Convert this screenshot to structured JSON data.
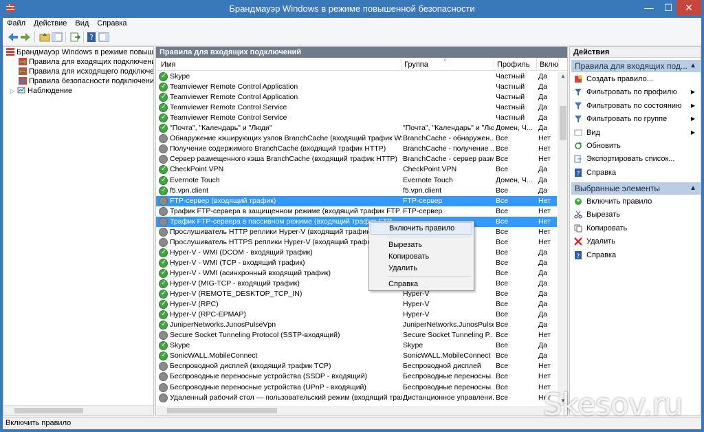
{
  "window": {
    "title": "Брандмауэр Windows в режиме повышенной безопасности",
    "min": "—",
    "max": "☐",
    "close": "✕"
  },
  "menu": [
    "Файл",
    "Действие",
    "Вид",
    "Справка"
  ],
  "tree": {
    "root": "Брандмауэр Windows в режиме повышенно",
    "items": [
      "Правила для входящих подключений",
      "Правила для исходящего подключения",
      "Правила безопасности подключения",
      "Наблюдение"
    ]
  },
  "center": {
    "header": "Правила для входящих подключений",
    "columns": [
      "Имя",
      "Группа",
      "Профиль",
      "Включ"
    ],
    "rows": [
      {
        "status": "on",
        "name": "Skype",
        "group": "",
        "profile": "Частный",
        "enabled": "Да"
      },
      {
        "status": "on",
        "name": "Teamviewer Remote Control Application",
        "group": "",
        "profile": "Частный",
        "enabled": "Да"
      },
      {
        "status": "on",
        "name": "Teamviewer Remote Control Application",
        "group": "",
        "profile": "Частный",
        "enabled": "Да"
      },
      {
        "status": "on",
        "name": "Teamviewer Remote Control Service",
        "group": "",
        "profile": "Частный",
        "enabled": "Да"
      },
      {
        "status": "on",
        "name": "Teamviewer Remote Control Service",
        "group": "",
        "profile": "Частный",
        "enabled": "Да"
      },
      {
        "status": "on",
        "name": "\"Почта\", \"Календарь\" и \"Люди\"",
        "group": "\"Почта\", \"Календарь\" и \"Люди\"",
        "profile": "Домен, Ч...",
        "enabled": "Да"
      },
      {
        "status": "off",
        "name": "Обнаружение кэширующих узлов BranchCache (входящий трафик WSD)",
        "group": "BranchCache - обнаружен...",
        "profile": "Все",
        "enabled": "Нет"
      },
      {
        "status": "off",
        "name": "Получение содержимого BranchCache (входящий трафик HTTP)",
        "group": "BranchCache - получение ...",
        "profile": "Все",
        "enabled": "Нет"
      },
      {
        "status": "off",
        "name": "Сервер размещенного кэша BranchCache (входящий трафик HTTP)",
        "group": "BranchCache - сервер разм...",
        "profile": "Все",
        "enabled": "Нет"
      },
      {
        "status": "on",
        "name": "CheckPoint.VPN",
        "group": "CheckPoint.VPN",
        "profile": "Все",
        "enabled": "Да"
      },
      {
        "status": "on",
        "name": "Evernote Touch",
        "group": "Evernote Touch",
        "profile": "Домен, Ч...",
        "enabled": "Да"
      },
      {
        "status": "on",
        "name": "f5.vpn.client",
        "group": "f5.vpn.client",
        "profile": "Все",
        "enabled": "Да"
      },
      {
        "status": "off",
        "name": "FTP-сервер (входящий трафик)",
        "group": "FTP-сервер",
        "profile": "Все",
        "enabled": "Нет",
        "selected": true
      },
      {
        "status": "off",
        "name": "Трафик FTP-сервера в защищенном режиме (входящий трафик FTP SSL)",
        "group": "FTP-сервер",
        "profile": "Все",
        "enabled": "Нет"
      },
      {
        "status": "off",
        "name": "Трафик FTP-сервера в пассивном режиме (входящий трафик FTP",
        "group": "",
        "profile": "Все",
        "enabled": "Нет",
        "selected": true
      },
      {
        "status": "off",
        "name": "Прослушиватель HTTP реплики Hyper-V (входящий трафик TCP)",
        "group": "",
        "profile": "Все",
        "enabled": "Нет"
      },
      {
        "status": "off",
        "name": "Прослушиватель HTTPS реплики Hyper-V (входящий трафик TCP)",
        "group": "",
        "profile": "Все",
        "enabled": "Нет"
      },
      {
        "status": "on",
        "name": "Hyper-V - WMI (DCOM - входящий трафик)",
        "group": "",
        "profile": "Все",
        "enabled": "Да"
      },
      {
        "status": "on",
        "name": "Hyper-V - WMI (TCP - входящий трафик)",
        "group": "",
        "profile": "Все",
        "enabled": "Да"
      },
      {
        "status": "on",
        "name": "Hyper-V - WMI (асинхронный входящий трафик)",
        "group": "",
        "profile": "Все",
        "enabled": "Да"
      },
      {
        "status": "on",
        "name": "Hyper-V (MIG-TCP - входящий трафик)",
        "group": "",
        "profile": "Все",
        "enabled": "Да"
      },
      {
        "status": "on",
        "name": "Hyper-V (REMOTE_DESKTOP_TCP_IN)",
        "group": "Hyper-V",
        "profile": "Все",
        "enabled": "Да"
      },
      {
        "status": "on",
        "name": "Hyper-V (RPC)",
        "group": "Hyper-V",
        "profile": "Все",
        "enabled": "Да"
      },
      {
        "status": "on",
        "name": "Hyper-V (RPC-EPMAP)",
        "group": "Hyper-V",
        "profile": "Все",
        "enabled": "Да"
      },
      {
        "status": "on",
        "name": "JuniperNetworks.JunosPulseVpn",
        "group": "JuniperNetworks.JunosPulse...",
        "profile": "Все",
        "enabled": "Да"
      },
      {
        "status": "off",
        "name": "Secure Socket Tunneling Protocol (SSTP-входящий)",
        "group": "Secure Socket Tunneling P...",
        "profile": "Все",
        "enabled": "Нет"
      },
      {
        "status": "on",
        "name": "Skype",
        "group": "Skype",
        "profile": "Все",
        "enabled": "Да"
      },
      {
        "status": "on",
        "name": "SonicWALL.MobileConnect",
        "group": "SonicWALL.MobileConnect",
        "profile": "Все",
        "enabled": "Да"
      },
      {
        "status": "off",
        "name": "Беспроводной дисплей (входящий трафик TCP)",
        "group": "Беспроводной дисплей",
        "profile": "Все",
        "enabled": "Нет"
      },
      {
        "status": "off",
        "name": "Беспроводные переносные устройства (SSDP - входящий)",
        "group": "Беспроводные переносны...",
        "profile": "Все",
        "enabled": "Нет"
      },
      {
        "status": "off",
        "name": "Беспроводные переносные устройства (UPnP - входящий)",
        "group": "Беспроводные переносны...",
        "profile": "Все",
        "enabled": "Нет"
      },
      {
        "status": "off",
        "name": "Удаленный рабочий стол — пользовательский режим (входящий трафик ...",
        "group": "Дистанционное управлени...",
        "profile": "Все",
        "enabled": "Нет"
      }
    ]
  },
  "actions": {
    "title": "Действия",
    "section1": "Правила для входящих под...",
    "section1_items": [
      {
        "label": "Создать правило...",
        "icon": "new-rule-icon",
        "sub": false
      },
      {
        "label": "Фильтровать по профилю",
        "icon": "filter-icon",
        "sub": true
      },
      {
        "label": "Фильтровать по состоянию",
        "icon": "filter-icon",
        "sub": true
      },
      {
        "label": "Фильтровать по группе",
        "icon": "filter-icon",
        "sub": true
      },
      {
        "label": "Вид",
        "icon": "view-icon",
        "sub": true
      },
      {
        "label": "Обновить",
        "icon": "refresh-icon",
        "sub": false
      },
      {
        "label": "Экспортировать список...",
        "icon": "export-icon",
        "sub": false
      },
      {
        "label": "Справка",
        "icon": "help-icon",
        "sub": false
      }
    ],
    "section2": "Выбранные элементы",
    "section2_items": [
      {
        "label": "Включить правило",
        "icon": "enable-icon"
      },
      {
        "label": "Вырезать",
        "icon": "cut-icon"
      },
      {
        "label": "Копировать",
        "icon": "copy-icon"
      },
      {
        "label": "Удалить",
        "icon": "delete-icon"
      },
      {
        "label": "Справка",
        "icon": "help-icon"
      }
    ]
  },
  "context_menu": [
    "Включить правило",
    "Вырезать",
    "Копировать",
    "Удалить",
    "Справка"
  ],
  "status": "Включить правило",
  "watermark": "Skesov.ru",
  "colors": {
    "accent": "#3a79b9",
    "selection": "#3399ff",
    "enabled": "#3ea83e",
    "disabled": "#8a8a8a"
  }
}
